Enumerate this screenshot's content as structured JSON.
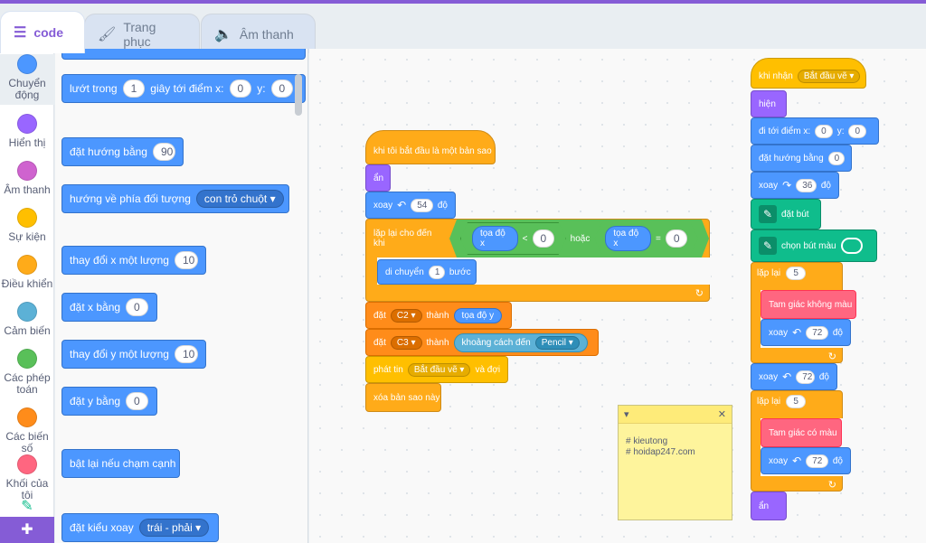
{
  "tabs": [
    {
      "label": "code",
      "icon": "code-icon",
      "active": true
    },
    {
      "label": "Trang phục",
      "icon": "brush-icon",
      "active": false
    },
    {
      "label": "Âm thanh",
      "icon": "speaker-icon",
      "active": false
    }
  ],
  "categories": [
    {
      "label": "Chuyển động",
      "color": "#4c97ff"
    },
    {
      "label": "Hiển thị",
      "color": "#9966ff"
    },
    {
      "label": "Âm thanh",
      "color": "#cf63cf"
    },
    {
      "label": "Sự kiện",
      "color": "#ffbf00"
    },
    {
      "label": "Điều khiển",
      "color": "#ffab19"
    },
    {
      "label": "Cảm biến",
      "color": "#5cb1d6"
    },
    {
      "label": "Các phép toán",
      "color": "#59c059"
    },
    {
      "label": "Các biến số",
      "color": "#ff8c1a"
    },
    {
      "label": "Khối của tôi",
      "color": "#ff6680"
    }
  ],
  "palette": {
    "glide": {
      "a": "lướt trong",
      "secs": "1",
      "b": "giây tới điểm x:",
      "x": "0",
      "c": "y:",
      "y": "0"
    },
    "point_dir": {
      "a": "đặt hướng bằng",
      "v": "90"
    },
    "point_towards": {
      "a": "hướng về phía đối tượng",
      "v": "con trỏ chuột"
    },
    "change_x": {
      "a": "thay đổi x một lượng",
      "v": "10"
    },
    "set_x": {
      "a": "đặt x bằng",
      "v": "0"
    },
    "change_y": {
      "a": "thay đổi y một lượng",
      "v": "10"
    },
    "set_y": {
      "a": "đặt y bằng",
      "v": "0"
    },
    "bounce": {
      "a": "bật lại nếu chạm cạnh"
    },
    "rotation": {
      "a": "đặt kiểu xoay",
      "v": "trái - phải"
    }
  },
  "script1": {
    "hat": "khi tôi bắt đầu là một bản sao",
    "hide": "ẩn",
    "turn": {
      "a": "xoay",
      "v": "54",
      "b": "độ"
    },
    "repeat_until": {
      "a": "lặp lại cho đến khi",
      "left_rep": "tọa độ x",
      "lt": "<",
      "left_val": "0",
      "or": "hoặc",
      "right_rep": "tọa độ x",
      "eq": "=",
      "right_val": "0"
    },
    "move": {
      "a": "di chuyển",
      "v": "1",
      "b": "bước"
    },
    "set_c2": {
      "a": "đặt",
      "var": "C2",
      "b": "thành",
      "rep": "tọa độ y"
    },
    "set_c3": {
      "a": "đặt",
      "var": "C3",
      "b": "thành",
      "rep": "khoảng cách đến",
      "target": "Pencil"
    },
    "broadcast": {
      "a": "phát tin",
      "msg": "Bắt đầu vẽ",
      "b": "và đợi"
    },
    "delete_clone": "xóa bản sao này"
  },
  "script2": {
    "hat": {
      "a": "khi nhận",
      "msg": "Bắt đầu vẽ"
    },
    "show": "hiện",
    "goto": {
      "a": "đi tới điểm x:",
      "x": "0",
      "b": "y:",
      "y": "0"
    },
    "point": {
      "a": "đặt hướng bằng",
      "v": "0"
    },
    "turn1": {
      "a": "xoay",
      "v": "36",
      "b": "độ"
    },
    "pen_down": "đặt bút",
    "pen_color": "chọn bút màu",
    "repeat1": {
      "a": "lặp lại",
      "v": "5"
    },
    "custom1": "Tam giác không màu",
    "turn2": {
      "a": "xoay",
      "v": "72",
      "b": "độ"
    },
    "turn3": {
      "a": "xoay",
      "v": "72",
      "b": "độ"
    },
    "repeat2": {
      "a": "lặp lại",
      "v": "5"
    },
    "custom2": "Tam giác có màu",
    "turn4": {
      "a": "xoay",
      "v": "72",
      "b": "độ"
    },
    "hide": "ẩn"
  },
  "note": {
    "text": "# kieutong\n# hoidap247.com",
    "collapse": "▾",
    "close": "✕"
  },
  "ext_icon": "extension-icon"
}
